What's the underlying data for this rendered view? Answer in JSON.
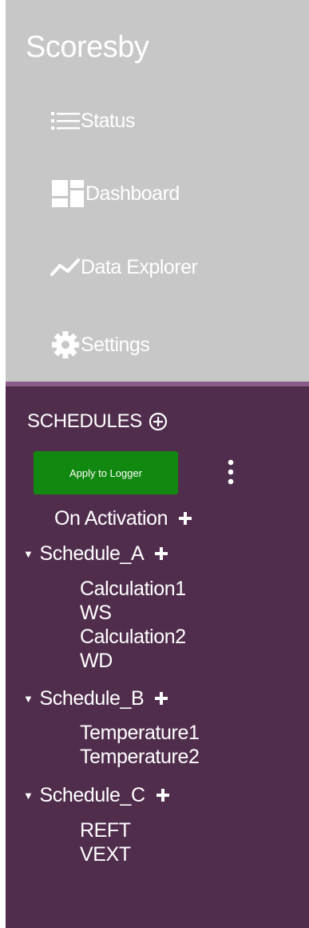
{
  "app": {
    "title": "Scoresby"
  },
  "nav": {
    "items": [
      {
        "label": "Status",
        "icon": "list-icon"
      },
      {
        "label": "Dashboard",
        "icon": "dashboard-icon"
      },
      {
        "label": "Data Explorer",
        "icon": "line-chart-icon"
      },
      {
        "label": "Settings",
        "icon": "gear-icon"
      }
    ]
  },
  "schedules": {
    "heading": "SCHEDULES",
    "apply_label": "Apply to Logger",
    "on_activation": "On Activation",
    "groups": [
      {
        "name": "Schedule_A",
        "items": [
          "Calculation1",
          "WS",
          "Calculation2",
          "WD"
        ]
      },
      {
        "name": "Schedule_B",
        "items": [
          "Temperature1",
          "Temperature2"
        ]
      },
      {
        "name": "Schedule_C",
        "items": [
          "REFT",
          "VEXT"
        ]
      }
    ]
  },
  "colors": {
    "top_panel": "#c7c7c7",
    "divider": "#8a5a88",
    "bottom_panel": "#502d4c",
    "apply_button": "#11880f"
  }
}
